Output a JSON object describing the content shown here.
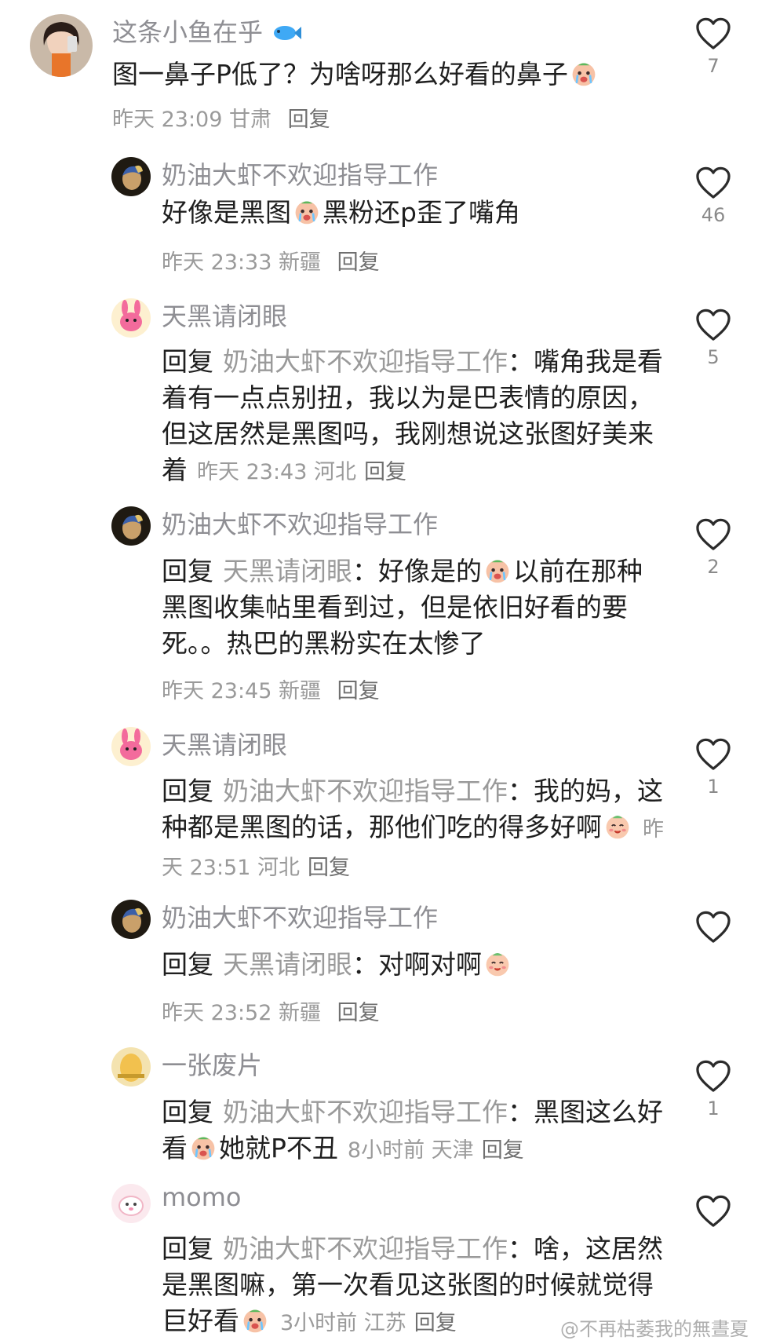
{
  "comments": [
    {
      "username": "这条小鱼在乎",
      "content": "图一鼻子P低了？为啥呀那么好看的鼻子",
      "time": "昨天 23:09",
      "location": "甘肃",
      "reply_label": "回复",
      "likes": "7"
    },
    {
      "username": "奶油大虾不欢迎指导工作",
      "content_a": "好像是黑图",
      "content_b": "黑粉还p歪了嘴角",
      "time": "昨天 23:33",
      "location": "新疆",
      "reply_label": "回复",
      "likes": "46"
    },
    {
      "username": "天黑请闭眼",
      "prefix": "回复",
      "target": "奶油大虾不欢迎指导工作",
      "content": "：嘴角我是看着有一点点别扭，我以为是巴表情的原因，但这居然是黑图吗，我刚想说这张图好美来着",
      "time": "昨天 23:43",
      "location": "河北",
      "reply_label": "回复",
      "likes": "5"
    },
    {
      "username": "奶油大虾不欢迎指导工作",
      "prefix": "回复",
      "target": "天黑请闭眼",
      "content_a": "：好像是的",
      "content_b": "以前在那种黑图收集帖里看到过，但是依旧好看的要死。。热巴的黑粉实在太惨了",
      "time": "昨天 23:45",
      "location": "新疆",
      "reply_label": "回复",
      "likes": "2"
    },
    {
      "username": "天黑请闭眼",
      "prefix": "回复",
      "target": "奶油大虾不欢迎指导工作",
      "content": "：我的妈，这种都是黑图的话，那他们吃的得多好啊",
      "time": "昨天 23:51",
      "location": "河北",
      "reply_label": "回复",
      "likes": "1"
    },
    {
      "username": "奶油大虾不欢迎指导工作",
      "prefix": "回复",
      "target": "天黑请闭眼",
      "content": "：对啊对啊",
      "time": "昨天 23:52",
      "location": "新疆",
      "reply_label": "回复",
      "likes": ""
    },
    {
      "username": "一张废片",
      "prefix": "回复",
      "target": "奶油大虾不欢迎指导工作",
      "content_a": "：黑图这么好看",
      "content_b": "她就P不丑",
      "time": "8小时前",
      "location": "天津",
      "reply_label": "回复",
      "likes": "1"
    },
    {
      "username": "momo",
      "prefix": "回复",
      "target": "奶油大虾不欢迎指导工作",
      "content": "：啥，这居然是黑图嘛，第一次看见这张图的时候就觉得巨好看",
      "time": "3小时前",
      "location": "江苏",
      "reply_label": "回复",
      "likes": ""
    }
  ],
  "watermark": "@不再枯萎我的無晝夏",
  "icons": {
    "like": "heart-outline-icon",
    "fish": "fish-emoji-icon",
    "crying": "crying-emoji-icon"
  },
  "colors": {
    "username": "#8e8e93",
    "meta": "#9a9a9a",
    "text": "#1f1f1f"
  }
}
